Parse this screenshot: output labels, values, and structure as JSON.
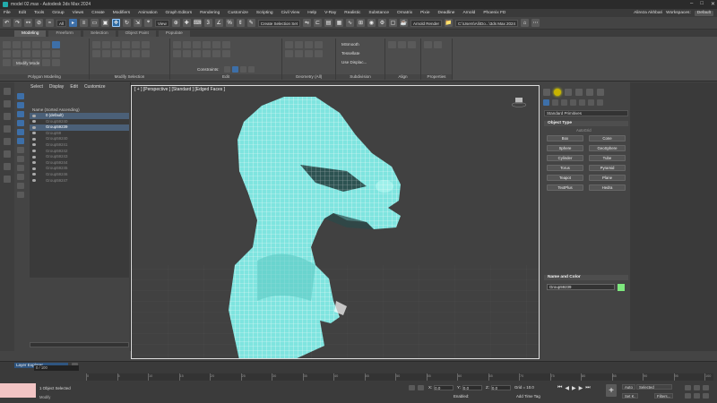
{
  "window": {
    "title": "model 02.max - Autodesk 3ds Max 2024",
    "controls": [
      "–",
      "□",
      "✕"
    ]
  },
  "menu": {
    "items": [
      "File",
      "Edit",
      "Tools",
      "Group",
      "Views",
      "Create",
      "Modifiers",
      "Animation",
      "Graph Editors",
      "Rendering",
      "Customize",
      "Scripting",
      "Civil View",
      "Help",
      "V-Ray",
      "Realistic",
      "Substance",
      "Ornatrix",
      "Pixie",
      "Deadline",
      "Arnold",
      "Phoenix FD"
    ],
    "user": "Alireza Akhbari",
    "workspaces_label": "Workspaces:",
    "workspace_value": "Default"
  },
  "toolbar": {
    "filter": "All",
    "viewport_view": "View",
    "selection_set": "Create Selection Set",
    "renderer": "Arnold Render",
    "project_path": "C:\\Users\\Ali\\Do...\\3ds Max 2024"
  },
  "ribbon": {
    "tabs": [
      "Modeling",
      "Freeform",
      "Selection",
      "Object Paint",
      "Populate"
    ],
    "active_tab": "Modeling",
    "sections": {
      "polygon_modeling": "Polygon Modeling",
      "modify_mode": "Modify Mode",
      "modify_selection": "Modify Selection",
      "edit": "Edit",
      "geometry_all": "Geometry (All)",
      "subdivision": "Subdivision",
      "align": "Align",
      "properties": "Properties"
    },
    "constraints_label": "Constraints:",
    "subdivision_items": [
      "MSmooth",
      "Tessellate",
      "Use Displac..."
    ]
  },
  "scene_explorer": {
    "tabs": [
      "Select",
      "Display",
      "Edit",
      "Customize"
    ],
    "column_header": "Name (Sorted Ascending)",
    "rows": [
      {
        "label": "0 (default)",
        "state": "sel"
      },
      {
        "label": "Group59240",
        "state": "dim"
      },
      {
        "label": "Group59239",
        "state": "sel"
      },
      {
        "label": "Group59",
        "state": "dim"
      },
      {
        "label": "Group59240",
        "state": "dim"
      },
      {
        "label": "Group59241",
        "state": "dim"
      },
      {
        "label": "Group59242",
        "state": "dim"
      },
      {
        "label": "Group59243",
        "state": "dim"
      },
      {
        "label": "Group59244",
        "state": "dim"
      },
      {
        "label": "Group59245",
        "state": "dim"
      },
      {
        "label": "Group59246",
        "state": "dim"
      },
      {
        "label": "Group59247",
        "state": "dim"
      }
    ],
    "layer_explorer": "Layer Explorer"
  },
  "viewport": {
    "label": "[ + ] [Perspective ] [Standard ] [Edged Faces ]",
    "mesh_color": "#7fe4df",
    "wire_color": "#ffffff"
  },
  "command_panel": {
    "category": "Standard Primitives",
    "object_type_title": "Object Type",
    "autogrid": "AutoGrid",
    "objects": [
      "Box",
      "Cone",
      "Sphere",
      "GeoSphere",
      "Cylinder",
      "Tube",
      "Torus",
      "Pyramid",
      "Teapot",
      "Plane",
      "TextPlus",
      "Hedra"
    ],
    "name_color_title": "Name and Color",
    "object_name": "Group59239",
    "color": "#7ee87e"
  },
  "timeline": {
    "frame_counter": "0 / 100",
    "ticks": [
      "0",
      "5",
      "10",
      "15",
      "20",
      "25",
      "30",
      "35",
      "40",
      "45",
      "50",
      "55",
      "60",
      "65",
      "70",
      "75",
      "80",
      "85",
      "90",
      "95",
      "100"
    ]
  },
  "status": {
    "selection": "1 Object Selected",
    "prompt": "Modify",
    "x_label": "X:",
    "x_value": "0.0",
    "y_label": "Y:",
    "y_value": "0.0",
    "z_label": "Z:",
    "z_value": "0.0",
    "grid": "Grid = 10.0",
    "enabled_label": "Enabled:",
    "add_time_tag": "Add Time Tag",
    "auto_key": "Auto",
    "set_key": "Set K.",
    "selected": "Selected",
    "filters": "Filters..."
  }
}
